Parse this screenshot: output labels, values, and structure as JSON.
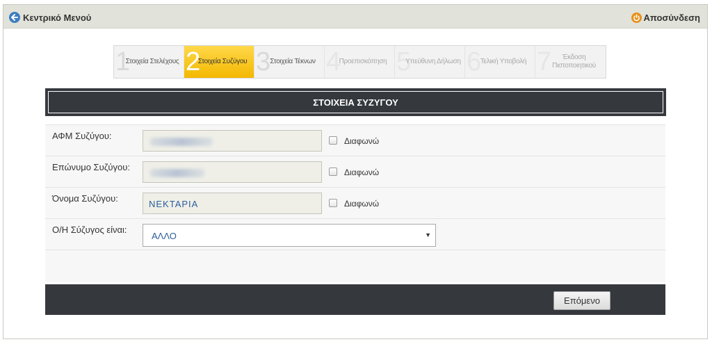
{
  "header": {
    "menu_label": "Κεντρικό Μενού",
    "menu_icon": "back-arrow-icon",
    "logout_label": "Αποσύνδεση",
    "logout_icon": "power-icon",
    "bar_color": "#e1e2d9",
    "menu_icon_color": "#3c7ec2",
    "logout_icon_color": "#e8901a"
  },
  "steps": [
    {
      "num": "1",
      "label": "Στοιχεία Στελέχους",
      "state": "done"
    },
    {
      "num": "2",
      "label": "Στοιχεία Συζύγου",
      "state": "active"
    },
    {
      "num": "3",
      "label": "Στοιχεία Τέκνων",
      "state": "done"
    },
    {
      "num": "4",
      "label": "Προεπισκόπηση",
      "state": "future"
    },
    {
      "num": "5",
      "label": "Υπεύθυνη Δήλωση",
      "state": "future"
    },
    {
      "num": "6",
      "label": "Τελική Υποβολή",
      "state": "future"
    },
    {
      "num": "7",
      "label": "Έκδοση Πιστοποιητικού",
      "state": "future"
    }
  ],
  "section": {
    "title": "ΣΤΟΙΧΕΙΑ ΣΥΖΥΓΟΥ",
    "header_color": "#35383d",
    "active_step_color": "#f3b800"
  },
  "form": {
    "afm_label": "ΑΦΜ Συζύγου:",
    "afm_value": "",
    "afm_disagree": "Διαφωνώ",
    "surname_label": "Επώνυμο Συζύγου:",
    "surname_value": "",
    "surname_disagree": "Διαφωνώ",
    "name_label": "Όνομα Συζύγου:",
    "name_value": "ΝΕΚΤΑΡΙΑ",
    "name_disagree": "Διαφωνώ",
    "spouse_type_label": "Ο/Η Σύζυγος είναι:",
    "spouse_type_value": "ΑΛΛΟ"
  },
  "footer": {
    "next_label": "Επόμενο"
  }
}
